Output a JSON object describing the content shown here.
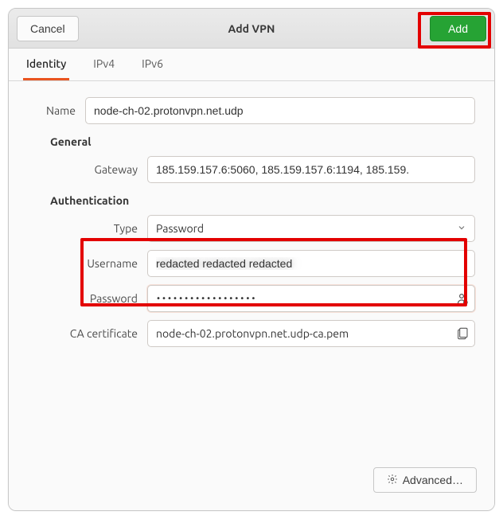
{
  "header": {
    "cancel": "Cancel",
    "title": "Add VPN",
    "add": "Add"
  },
  "tabs": {
    "identity": "Identity",
    "ipv4": "IPv4",
    "ipv6": "IPv6"
  },
  "form": {
    "name_label": "Name",
    "name_value": "node-ch-02.protonvpn.net.udp",
    "general_section": "General",
    "gateway_label": "Gateway",
    "gateway_value": "185.159.157.6:5060, 185.159.157.6:1194, 185.159.",
    "auth_section": "Authentication",
    "type_label": "Type",
    "type_value": "Password",
    "username_label": "Username",
    "username_value": "redacted redacted redacted",
    "password_label": "Password",
    "password_value": "••••••••••••••••••",
    "ca_label": "CA certificate",
    "ca_value": "node-ch-02.protonvpn.net.udp-ca.pem"
  },
  "footer": {
    "advanced": "Advanced…"
  }
}
